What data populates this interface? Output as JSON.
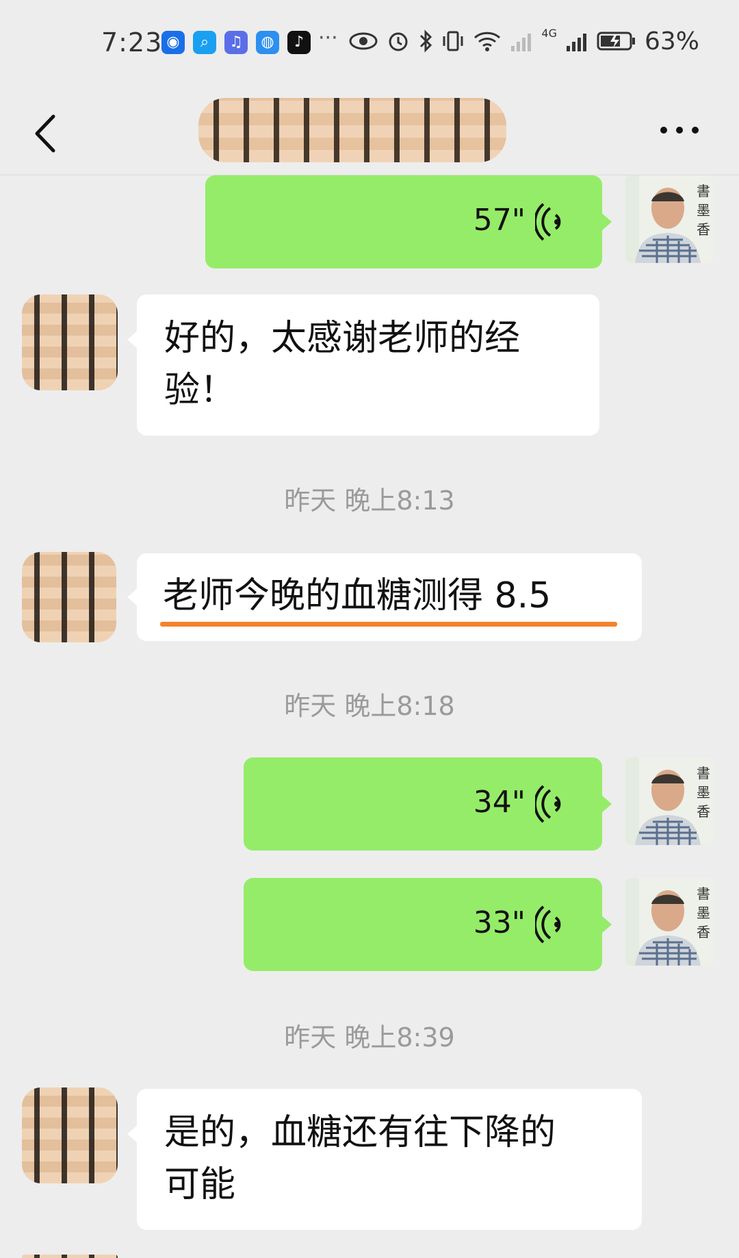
{
  "status_bar": {
    "time": "7:23",
    "more_indicator": "···",
    "network": "4G",
    "battery": "63%"
  },
  "chat": {
    "title_redacted": "",
    "back_icon": "chevron-left-icon",
    "more_icon": "more-dots-icon"
  },
  "messages": [
    {
      "side": "me",
      "type": "voice",
      "duration": "57\""
    },
    {
      "side": "other",
      "type": "text",
      "text_lines": [
        "好的，太感谢老师的经",
        "验！"
      ]
    },
    {
      "type": "timestamp",
      "text": "昨天 晚上8:13"
    },
    {
      "side": "other",
      "type": "text",
      "text": "老师今晚的血糖测得 8.5",
      "highlighted": true
    },
    {
      "type": "timestamp",
      "text": "昨天 晚上8:18"
    },
    {
      "side": "me",
      "type": "voice",
      "duration": "34\""
    },
    {
      "side": "me",
      "type": "voice",
      "duration": "33\""
    },
    {
      "type": "timestamp",
      "text": "昨天 晚上8:39"
    },
    {
      "side": "other",
      "type": "text",
      "text_lines": [
        "是的，血糖还有往下降的",
        "可能"
      ]
    }
  ],
  "colors": {
    "background": "#ededed",
    "my_bubble": "#95ec69",
    "other_bubble": "#ffffff",
    "highlight": "#f5822b",
    "timestamp": "#9a9a9a"
  }
}
